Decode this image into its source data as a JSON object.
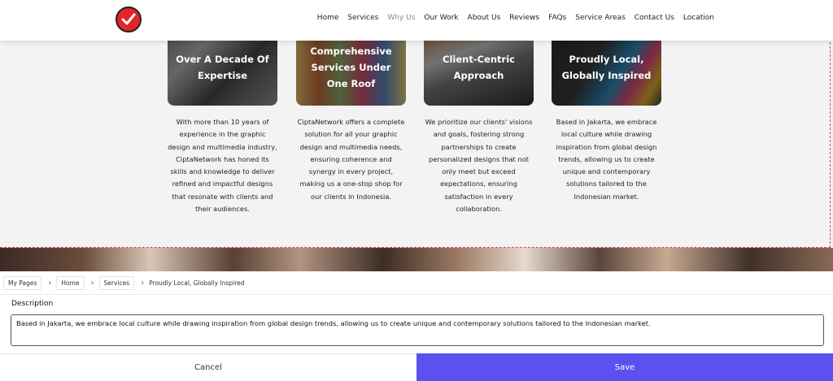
{
  "nav": {
    "items": [
      "Home",
      "Services",
      "Why Us",
      "Our Work",
      "About Us",
      "Reviews",
      "FAQs",
      "Service Areas",
      "Contact Us",
      "Location"
    ],
    "active": "Why Us"
  },
  "cards": [
    {
      "title": "Over A Decade Of Expertise",
      "description": "With more than 10 years of experience in the graphic design and multimedia industry, CiptaNetwork has honed its skills and knowledge to deliver refined and impactful designs that resonate with clients and their audiences."
    },
    {
      "title": "Comprehensive Services Under One Roof",
      "description": "CiptaNetwork offers a complete solution for all your graphic design and multimedia needs, ensuring coherence and synergy in every project, making us a one-stop shop for our clients in Indonesia."
    },
    {
      "title": "Client-Centric Approach",
      "description": "We prioritize our clients' visions and goals, fostering strong partnerships to create personalized designs that not only meet but exceed expectations, ensuring satisfaction in every collaboration."
    },
    {
      "title": "Proudly Local, Globally Inspired",
      "description": "Based in Jakarta, we embrace local culture while drawing inspiration from global design trends, allowing us to create unique and contemporary solutions tailored to the Indonesian market."
    }
  ],
  "breadcrumb": {
    "items": [
      "My Pages",
      "Home",
      "Services"
    ],
    "current": "Proudly Local, Globally Inspired"
  },
  "editor": {
    "label": "Description",
    "value": "Based in Jakarta, we embrace local culture while drawing inspiration from global design trends, allowing us to create unique and contemporary solutions tailored to the Indonesian market."
  },
  "actions": {
    "cancel": "Cancel",
    "save": "Save"
  },
  "colors": {
    "accent": "#5b51f0",
    "logo": "#e3242b",
    "selection_outline": "#e0445a"
  },
  "icons": {
    "logo": "checkmark-logo-icon",
    "separator": "chevron-right-icon"
  }
}
